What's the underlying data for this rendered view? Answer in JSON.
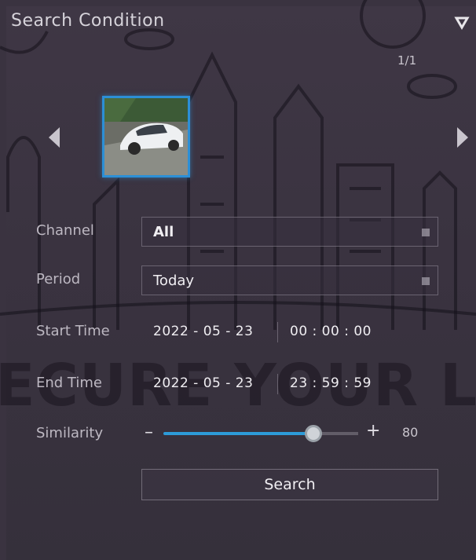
{
  "header": {
    "title": "Search Condition",
    "collapse_icon": "chevron-down-icon"
  },
  "pager": {
    "text": "1/1"
  },
  "thumbnails": [
    {
      "description": "white car thumbnail",
      "selected": true
    }
  ],
  "form": {
    "channel": {
      "label": "Channel",
      "value": "All"
    },
    "period": {
      "label": "Period",
      "value": "Today"
    },
    "start_time": {
      "label": "Start Time",
      "date": "2022 - 05 - 23",
      "time": "00 : 00 : 00"
    },
    "end_time": {
      "label": "End Time",
      "date": "2022 - 05 - 23",
      "time": "23 : 59 : 59"
    },
    "similarity": {
      "label": "Similarity",
      "minus": "–",
      "plus": "+",
      "value": "80",
      "fraction": 0.8
    }
  },
  "search_button": {
    "label": "Search"
  },
  "watermark": {
    "text": "ECURE YOUR L"
  },
  "colors": {
    "accent": "#2d9bd8",
    "background": "#3a3340"
  }
}
